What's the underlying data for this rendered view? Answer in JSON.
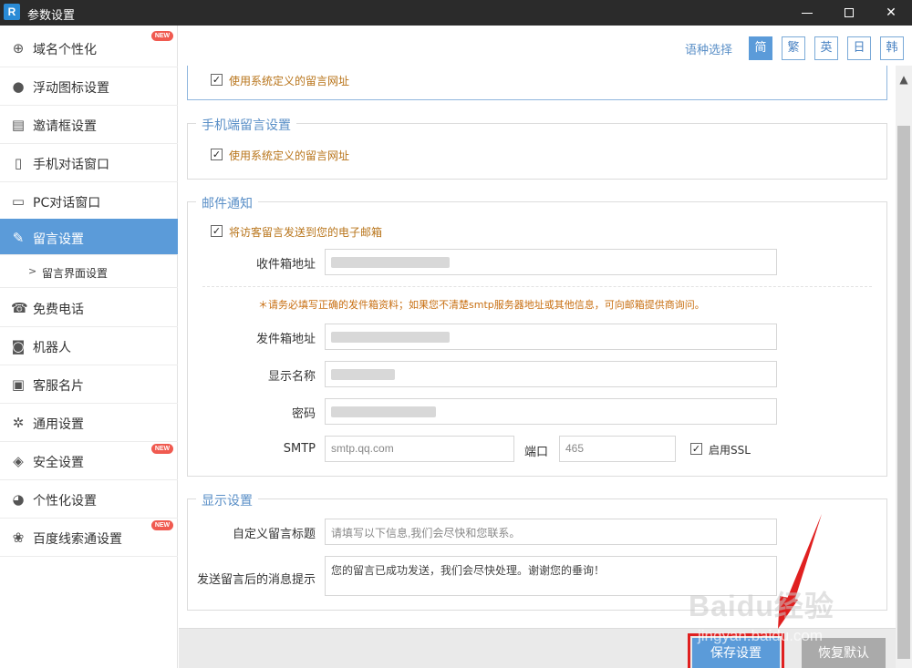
{
  "window": {
    "title": "参数设置",
    "app_icon": "R"
  },
  "sidebar": {
    "items": [
      {
        "label": "域名个性化",
        "icon": "globe-icon",
        "glyph": "⊕",
        "badge": "NEW"
      },
      {
        "label": "浮动图标设置",
        "icon": "balloon-icon",
        "glyph": "●",
        "badge": ""
      },
      {
        "label": "邀请框设置",
        "icon": "invite-icon",
        "glyph": "▤",
        "badge": ""
      },
      {
        "label": "手机对话窗口",
        "icon": "phone-icon",
        "glyph": "▯",
        "badge": ""
      },
      {
        "label": "PC对话窗口",
        "icon": "monitor-icon",
        "glyph": "▭",
        "badge": ""
      },
      {
        "label": "留言设置",
        "icon": "edit-icon",
        "glyph": "✎",
        "badge": "",
        "active": true
      },
      {
        "label": "免费电话",
        "icon": "telephone-icon",
        "glyph": "☎",
        "badge": ""
      },
      {
        "label": "机器人",
        "icon": "robot-icon",
        "glyph": "◙",
        "badge": ""
      },
      {
        "label": "客服名片",
        "icon": "card-icon",
        "glyph": "▣",
        "badge": ""
      },
      {
        "label": "通用设置",
        "icon": "gear-icon",
        "glyph": "✲",
        "badge": ""
      },
      {
        "label": "安全设置",
        "icon": "shield-icon",
        "glyph": "◈",
        "badge": "NEW"
      },
      {
        "label": "个性化设置",
        "icon": "palette-icon",
        "glyph": "◕",
        "badge": ""
      },
      {
        "label": "百度线索通设置",
        "icon": "paw-icon",
        "glyph": "❀",
        "badge": "NEW"
      }
    ],
    "sub_item": {
      "label": "留言界面设置",
      "arrow": ">"
    }
  },
  "lang": {
    "label": "语种选择",
    "options": [
      "简",
      "繁",
      "英",
      "日",
      "韩"
    ],
    "selected": "简"
  },
  "sections": {
    "pc": {
      "checkbox_label": "使用系统定义的留言网址",
      "checked": true
    },
    "mobile": {
      "title": "手机端留言设置",
      "checkbox_label": "使用系统定义的留言网址",
      "checked": true
    },
    "email": {
      "title": "邮件通知",
      "checkbox_label": "将访客留言发送到您的电子邮箱",
      "checked": true,
      "inbox_label": "收件箱地址",
      "note": "＊请务必填写正确的发件箱资料；如果您不清楚smtp服务器地址或其他信息，可向邮箱提供商询问。",
      "sender_label": "发件箱地址",
      "display_name_label": "显示名称",
      "password_label": "密码",
      "smtp_label": "SMTP",
      "smtp_value": "smtp.qq.com",
      "port_label": "端口",
      "port_value": "465",
      "ssl_label": "启用SSL",
      "ssl_checked": true
    },
    "display": {
      "title": "显示设置",
      "title_label": "自定义留言标题",
      "title_placeholder": "请填写以下信息,我们会尽快和您联系。",
      "message_label": "发送留言后的消息提示",
      "message_value": "您的留言已成功发送，我们会尽快处理。谢谢您的垂询！"
    }
  },
  "buttons": {
    "save": "保存设置",
    "reset": "恢复默认"
  },
  "watermark": {
    "brand": "Baidu经验",
    "url": "jingyan.baidu.com"
  },
  "colors": {
    "accent": "#5b9bd9",
    "highlight": "#e02020",
    "warning_text": "#c86f12"
  }
}
